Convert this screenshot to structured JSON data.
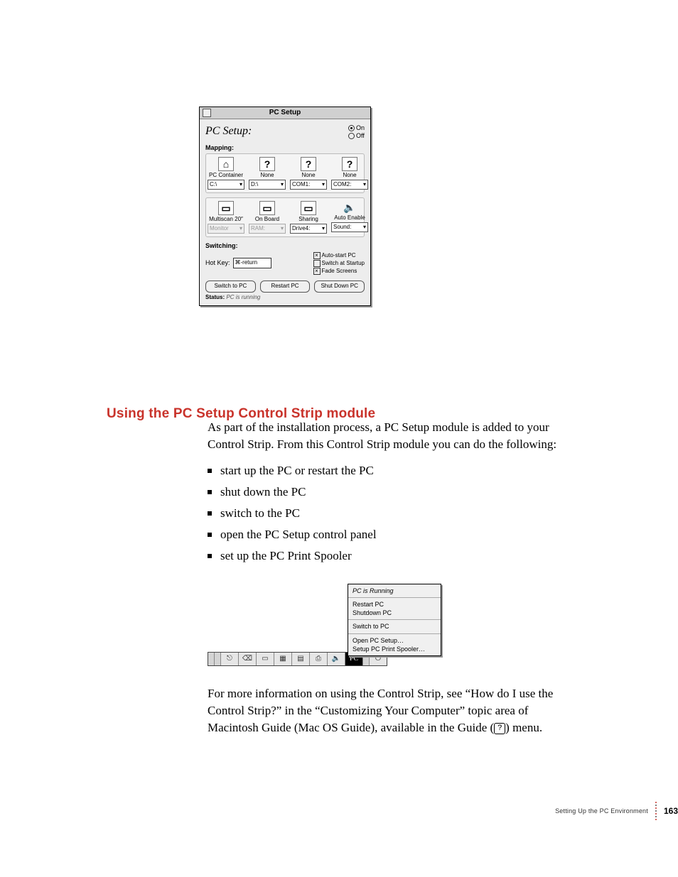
{
  "dialog": {
    "title": "PC Setup",
    "header": "PC Setup:",
    "radios": {
      "on": "On",
      "off": "Off"
    },
    "map_label": "Mapping:",
    "map_row1": [
      {
        "icon": "⌂",
        "label": "PC Container",
        "select": "C:\\",
        "enabled": true
      },
      {
        "icon": "?",
        "label": "None",
        "select": "D:\\",
        "enabled": true
      },
      {
        "icon": "?",
        "label": "None",
        "select": "COM1:",
        "enabled": true
      },
      {
        "icon": "?",
        "label": "None",
        "select": "COM2:",
        "enabled": true
      }
    ],
    "map_row2": [
      {
        "icon": "▭",
        "label": "Multiscan 20″",
        "select": "Monitor",
        "enabled": false
      },
      {
        "icon": "▭",
        "label": "On Board",
        "select": "RAM:",
        "enabled": false
      },
      {
        "icon": "▭",
        "label": "Sharing",
        "select": "Drive4:",
        "enabled": true
      },
      {
        "icon": "🔈",
        "label": "Auto Enable",
        "select": "Sound:",
        "enabled": true
      }
    ],
    "switching": {
      "label": "Switching:",
      "hotkey_label": "Hot Key:",
      "hotkey_value": "⌘-return",
      "checks": [
        {
          "label": "Auto-start PC",
          "checked": true
        },
        {
          "label": "Switch at Startup",
          "checked": false
        },
        {
          "label": "Fade Screens",
          "checked": true
        }
      ]
    },
    "buttons": {
      "switch": "Switch to PC",
      "restart": "Restart PC",
      "shutdown": "Shut Down PC"
    },
    "status_label": "Status:",
    "status_value": "PC is running"
  },
  "heading": "Using the PC Setup Control Strip module",
  "para1": "As part of the installation process, a PC Setup module is added to your Control Strip. From this Control Strip module you can do the following:",
  "bullets": [
    "start up the PC or restart the PC",
    "shut down the PC",
    "switch to the PC",
    "open the PC Setup control panel",
    "set up the PC Print Spooler"
  ],
  "cs_popup": {
    "hdr": "PC is Running",
    "g1a": "Restart PC",
    "g1b": "Shutdown PC",
    "g2": "Switch to PC",
    "g3a": "Open PC Setup…",
    "g3b": "Setup PC Print Spooler…"
  },
  "cs_icons": [
    "⎋",
    "⌫",
    "▭",
    "▦",
    "▤",
    "⎙",
    "🔈",
    "PC",
    "⏻"
  ],
  "para2_a": "For more information on using the Control Strip, see “How do I use the Control Strip?” in the “Customizing Your Computer” topic area of Macintosh Guide (Mac OS Guide), available in the Guide (",
  "para2_b": ") menu.",
  "guide_glyph": "?",
  "footer": {
    "chapter": "Setting Up the PC Environment",
    "page": "163"
  }
}
